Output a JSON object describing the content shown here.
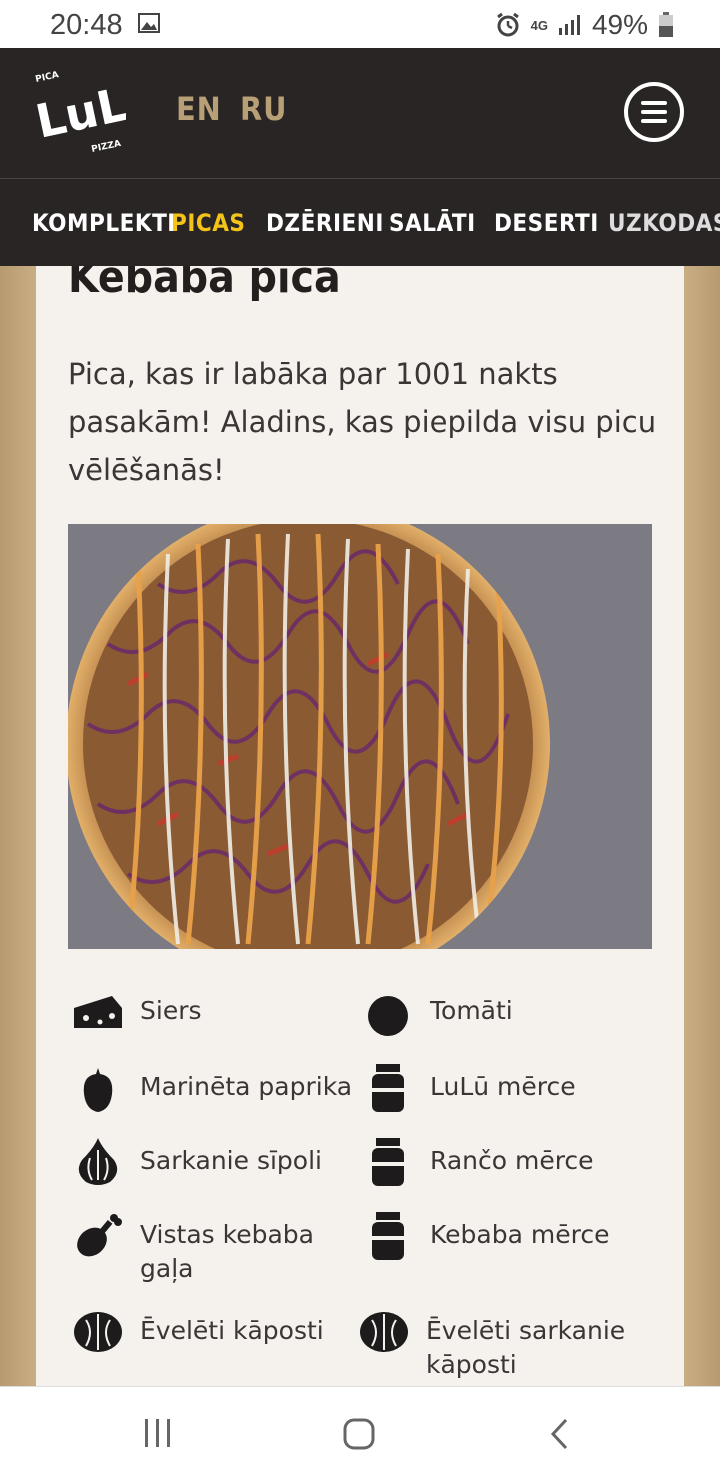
{
  "status": {
    "time": "20:48",
    "network": "4G",
    "battery": "49%"
  },
  "header": {
    "logo": {
      "top": "PICA",
      "main": "LuLū",
      "bottom": "PIZZA"
    },
    "lang_en": "EN",
    "lang_ru": "RU"
  },
  "nav": {
    "items": [
      "KOMPLEKTI",
      "PICAS",
      "DZĒRIENI",
      "SALĀTI",
      "DESERTI",
      "UZKODAS/"
    ],
    "active": "PICAS"
  },
  "product": {
    "title": "Kebaba pica",
    "description": "Pica, kas ir labāka par 1001 nakts pasakām! Aladins, kas piepilda visu picu vēlēšanās!"
  },
  "ingredients": [
    {
      "label": "Siers",
      "icon": "cheese-icon"
    },
    {
      "label": "Tomāti",
      "icon": "tomato-icon"
    },
    {
      "label": "Marinēta paprika",
      "icon": "pepper-icon"
    },
    {
      "label": "LuLū mērce",
      "icon": "sauce-jar-icon"
    },
    {
      "label": "Sarkanie sīpoli",
      "icon": "onion-icon"
    },
    {
      "label": "Rančo mērce",
      "icon": "sauce-jar-icon"
    },
    {
      "label": "Vistas kebaba gaļa",
      "icon": "chicken-leg-icon"
    },
    {
      "label": "Kebaba mērce",
      "icon": "sauce-jar-icon"
    },
    {
      "label": "Ēvelēti kāposti",
      "icon": "cabbage-icon"
    },
    {
      "label": "Ēvelēti sarkanie kāposti",
      "icon": "cabbage-icon"
    }
  ]
}
